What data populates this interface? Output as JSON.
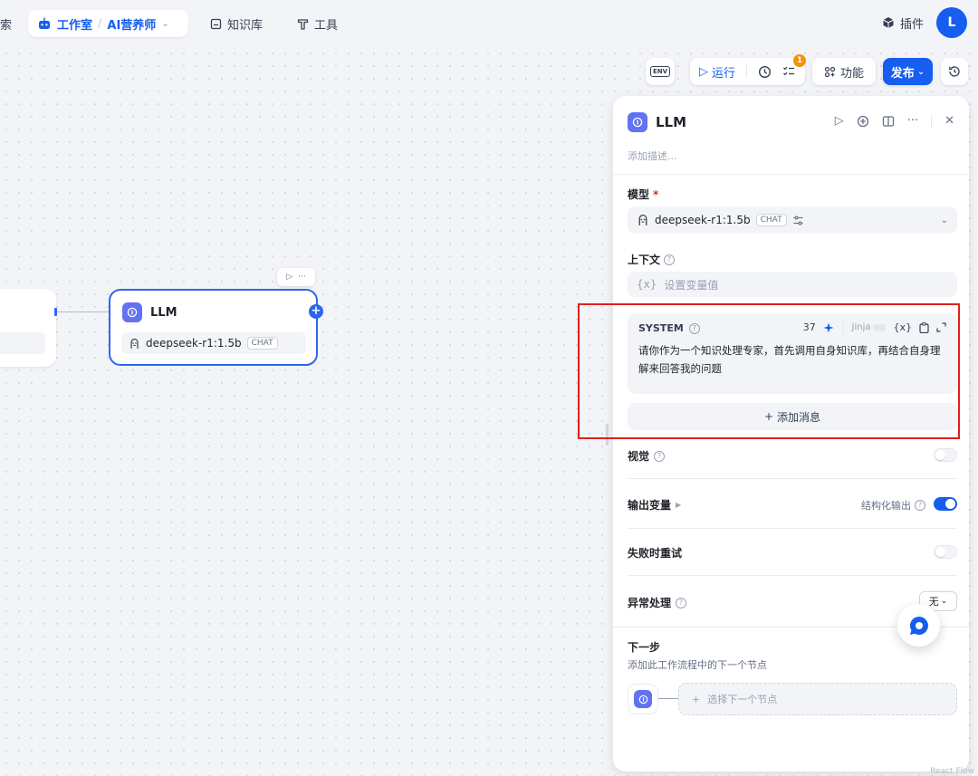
{
  "nav": {
    "cut_label": "索",
    "studio_label": "工作室",
    "separator": "/",
    "app_label": "AI营养师",
    "knowledge_label": "知识库",
    "tools_label": "工具",
    "plugin_label": "插件",
    "avatar_letter": "L"
  },
  "canvas_node": {
    "title": "LLM",
    "model": "deepseek-r1:1.5b",
    "badge": "CHAT"
  },
  "toolbar": {
    "env_label": "ENV",
    "run_label": "运行",
    "checklist_count": "1",
    "features_label": "功能",
    "publish_label": "发布"
  },
  "panel": {
    "title": "LLM",
    "description_placeholder": "添加描述...",
    "model_label": "模型",
    "required_mark": "*",
    "model_name": "deepseek-r1:1.5b",
    "model_badge": "CHAT",
    "context_label": "上下文",
    "context_var_icon": "{x}",
    "context_placeholder": "设置变量值",
    "system": {
      "role": "SYSTEM",
      "char_count": "37",
      "jinja_label": "Jinja",
      "var_label": "{x}",
      "prompt": "请你作为一个知识处理专家，首先调用自身知识库，再结合自身理解来回答我的问题"
    },
    "add_message_label": "添加消息",
    "vision_label": "视觉",
    "output_vars_label": "输出变量",
    "structured_output_label": "结构化输出",
    "structured_output_on": true,
    "retry_label": "失败时重试",
    "error_handling_label": "异常处理",
    "error_handling_value": "无",
    "next_step_title": "下一步",
    "next_step_desc": "添加此工作流程中的下一个节点",
    "next_node_placeholder": "选择下一个节点"
  },
  "watermark": "React Flow",
  "colors": {
    "accent": "#155eef",
    "node_icon": "#6172f3",
    "warning_badge": "#f79009",
    "highlight_box": "#e0201b"
  }
}
